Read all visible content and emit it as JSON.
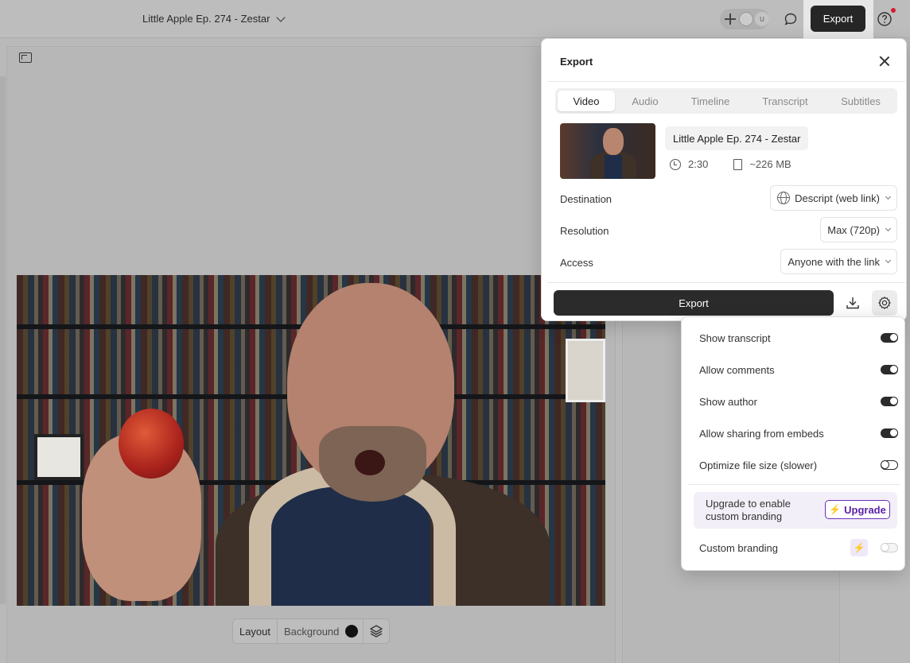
{
  "topbar": {
    "project_title": "Little Apple Ep. 274 - Zestar",
    "avatar_initial": "U",
    "export_label": "Export"
  },
  "layout_bar": {
    "layout_label": "Layout",
    "background_label": "Background"
  },
  "export_panel": {
    "title": "Export",
    "tabs": [
      {
        "label": "Video",
        "active": true
      },
      {
        "label": "Audio",
        "active": false
      },
      {
        "label": "Timeline",
        "active": false
      },
      {
        "label": "Transcript",
        "active": false
      },
      {
        "label": "Subtitles",
        "active": false
      }
    ],
    "file_name": "Little Apple Ep. 274 - Zestar",
    "duration": "2:30",
    "size": "~226 MB",
    "destination": {
      "label": "Destination",
      "value": "Descript (web link)"
    },
    "resolution": {
      "label": "Resolution",
      "value": "Max (720p)"
    },
    "access": {
      "label": "Access",
      "value": "Anyone with the link"
    },
    "export_button": "Export"
  },
  "settings": {
    "toggles": [
      {
        "label": "Show transcript",
        "on": true
      },
      {
        "label": "Allow comments",
        "on": true
      },
      {
        "label": "Show author",
        "on": true
      },
      {
        "label": "Allow sharing from embeds",
        "on": true
      },
      {
        "label": "Optimize file size (slower)",
        "on": false
      }
    ],
    "upgrade_text_line1": "Upgrade to enable",
    "upgrade_text_line2": "custom branding",
    "upgrade_button": "Upgrade",
    "custom_branding": {
      "label": "Custom branding",
      "on": false,
      "disabled": true
    }
  },
  "colors": {
    "accent_purple": "#6a2fb8",
    "dark_button": "#2b2b2b",
    "notification_red": "#d21f2e"
  }
}
